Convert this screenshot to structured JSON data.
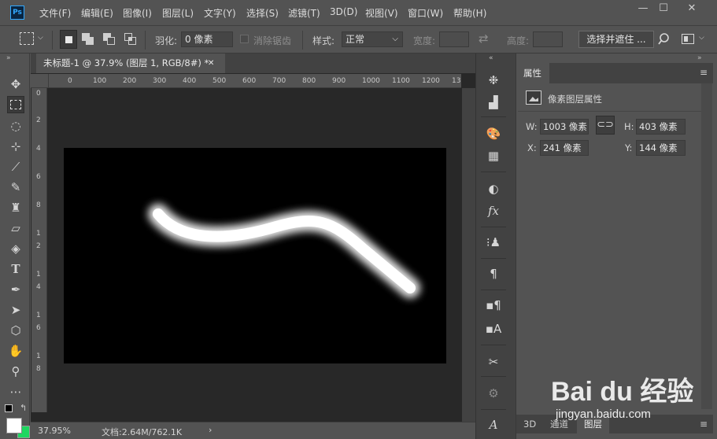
{
  "app": {
    "logo": "Ps"
  },
  "menu": [
    "文件(F)",
    "编辑(E)",
    "图像(I)",
    "图层(L)",
    "文字(Y)",
    "选择(S)",
    "滤镜(T)",
    "3D(D)",
    "视图(V)",
    "窗口(W)",
    "帮助(H)"
  ],
  "window_controls": {
    "minimize": "—",
    "maximize": "☐",
    "close": "✕"
  },
  "options": {
    "feather_label": "羽化:",
    "feather_value": "0 像素",
    "antialias_label": "消除锯齿",
    "style_label": "样式:",
    "style_value": "正常",
    "width_label": "宽度:",
    "height_label": "高度:",
    "select_mask_button": "选择并遮住 ..."
  },
  "document": {
    "tab_title": "未标题-1 @ 37.9% (图层 1, RGB/8#) *",
    "tab_close": "✕",
    "ruler_top_labels": [
      "0",
      "100",
      "200",
      "300",
      "400",
      "500",
      "600",
      "700",
      "800",
      "900",
      "1000",
      "1100",
      "1200",
      "13"
    ],
    "ruler_left_labels": [
      "0",
      "2",
      "4",
      "6",
      "8",
      "1",
      "2",
      "1",
      "4",
      "1",
      "6",
      "1",
      "8"
    ],
    "zoom": "37.95%",
    "doc_size": "文档:2.64M/762.1K",
    "status_arrow": "›"
  },
  "properties": {
    "tab_label": "属性",
    "section_title": "像素图层属性",
    "w_label": "W:",
    "w_value": "1003 像素",
    "h_label": "H:",
    "h_value": "403 像素",
    "x_label": "X:",
    "x_value": "241 像素",
    "y_label": "Y:",
    "y_value": "144 像素"
  },
  "bottom_tabs": [
    "3D",
    "通道",
    "图层"
  ],
  "watermark": {
    "brand": "Bai du 经验",
    "url": "jingyan.baidu.com"
  },
  "colors": {
    "foreground": "#ffffff",
    "background": "#1ed760",
    "accent": "#31a8ff"
  }
}
